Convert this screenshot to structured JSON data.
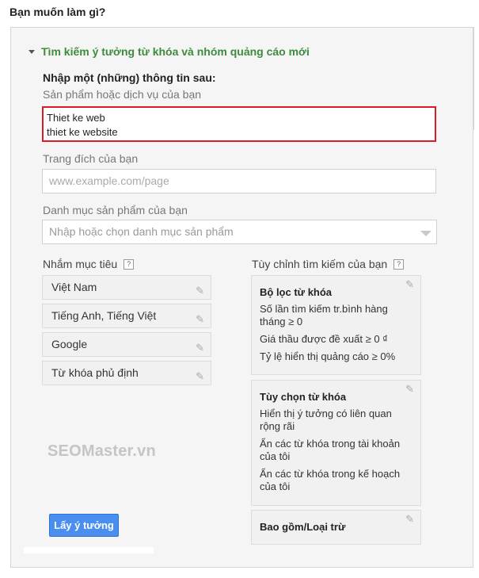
{
  "page_title": "Bạn muốn làm gì?",
  "section_title": "Tìm kiếm ý tưởng từ khóa và nhóm quảng cáo mới",
  "form": {
    "heading": "Nhập một (những) thông tin sau:",
    "product_label": "Sản phẩm hoặc dịch vụ của bạn",
    "product_lines": [
      "Thiet ke web",
      "thiet ke website"
    ],
    "landing_label": "Trang đích của bạn",
    "landing_placeholder": "www.example.com/page",
    "category_label": "Danh mục sản phẩm của bạn",
    "category_placeholder": "Nhập hoặc chọn danh mục sản phẩm"
  },
  "targeting": {
    "title": "Nhắm mục tiêu",
    "help": "?",
    "items": [
      "Việt Nam",
      "Tiếng Anh, Tiếng Việt",
      "Google",
      "Từ khóa phủ định"
    ]
  },
  "customize": {
    "title": "Tùy chỉnh tìm kiếm của bạn",
    "help": "?",
    "filters": {
      "title": "Bộ lọc từ khóa",
      "lines": [
        "Số lần tìm kiếm tr.bình hàng tháng ≥ 0",
        "Giá thầu được đề xuất ≥ 0 ₫",
        "Tỷ lệ hiển thị quảng cáo ≥ 0%"
      ]
    },
    "options": {
      "title": "Tùy chọn từ khóa",
      "lines": [
        "Hiển thị ý tưởng có liên quan rộng rãi",
        "Ẩn các từ khóa trong tài khoản của tôi",
        "Ẩn các từ khóa trong kế hoạch của tôi"
      ]
    },
    "include": {
      "title": "Bao gồm/Loại trừ"
    }
  },
  "watermark": "SEOMaster.vn",
  "submit_label": "Lấy ý tưởng",
  "icons": {
    "edit": "pencil-icon",
    "expand": "triangle-down-icon",
    "dropdown": "chevron-down-icon"
  },
  "colors": {
    "accent_green": "#3d8b3d",
    "error_red": "#dd1a2a",
    "button_blue": "#4a8ff0"
  }
}
